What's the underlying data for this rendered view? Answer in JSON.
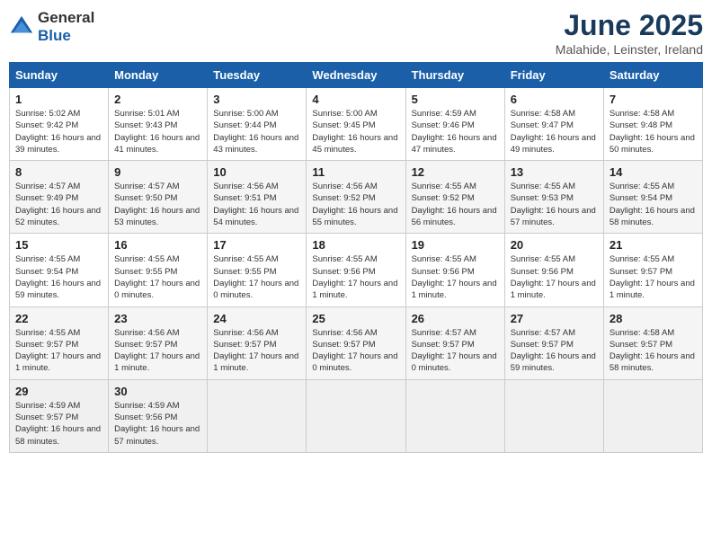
{
  "logo": {
    "general": "General",
    "blue": "Blue"
  },
  "title": "June 2025",
  "location": "Malahide, Leinster, Ireland",
  "weekdays": [
    "Sunday",
    "Monday",
    "Tuesday",
    "Wednesday",
    "Thursday",
    "Friday",
    "Saturday"
  ],
  "weeks": [
    [
      {
        "day": "1",
        "sunrise": "Sunrise: 5:02 AM",
        "sunset": "Sunset: 9:42 PM",
        "daylight": "Daylight: 16 hours and 39 minutes."
      },
      {
        "day": "2",
        "sunrise": "Sunrise: 5:01 AM",
        "sunset": "Sunset: 9:43 PM",
        "daylight": "Daylight: 16 hours and 41 minutes."
      },
      {
        "day": "3",
        "sunrise": "Sunrise: 5:00 AM",
        "sunset": "Sunset: 9:44 PM",
        "daylight": "Daylight: 16 hours and 43 minutes."
      },
      {
        "day": "4",
        "sunrise": "Sunrise: 5:00 AM",
        "sunset": "Sunset: 9:45 PM",
        "daylight": "Daylight: 16 hours and 45 minutes."
      },
      {
        "day": "5",
        "sunrise": "Sunrise: 4:59 AM",
        "sunset": "Sunset: 9:46 PM",
        "daylight": "Daylight: 16 hours and 47 minutes."
      },
      {
        "day": "6",
        "sunrise": "Sunrise: 4:58 AM",
        "sunset": "Sunset: 9:47 PM",
        "daylight": "Daylight: 16 hours and 49 minutes."
      },
      {
        "day": "7",
        "sunrise": "Sunrise: 4:58 AM",
        "sunset": "Sunset: 9:48 PM",
        "daylight": "Daylight: 16 hours and 50 minutes."
      }
    ],
    [
      {
        "day": "8",
        "sunrise": "Sunrise: 4:57 AM",
        "sunset": "Sunset: 9:49 PM",
        "daylight": "Daylight: 16 hours and 52 minutes."
      },
      {
        "day": "9",
        "sunrise": "Sunrise: 4:57 AM",
        "sunset": "Sunset: 9:50 PM",
        "daylight": "Daylight: 16 hours and 53 minutes."
      },
      {
        "day": "10",
        "sunrise": "Sunrise: 4:56 AM",
        "sunset": "Sunset: 9:51 PM",
        "daylight": "Daylight: 16 hours and 54 minutes."
      },
      {
        "day": "11",
        "sunrise": "Sunrise: 4:56 AM",
        "sunset": "Sunset: 9:52 PM",
        "daylight": "Daylight: 16 hours and 55 minutes."
      },
      {
        "day": "12",
        "sunrise": "Sunrise: 4:55 AM",
        "sunset": "Sunset: 9:52 PM",
        "daylight": "Daylight: 16 hours and 56 minutes."
      },
      {
        "day": "13",
        "sunrise": "Sunrise: 4:55 AM",
        "sunset": "Sunset: 9:53 PM",
        "daylight": "Daylight: 16 hours and 57 minutes."
      },
      {
        "day": "14",
        "sunrise": "Sunrise: 4:55 AM",
        "sunset": "Sunset: 9:54 PM",
        "daylight": "Daylight: 16 hours and 58 minutes."
      }
    ],
    [
      {
        "day": "15",
        "sunrise": "Sunrise: 4:55 AM",
        "sunset": "Sunset: 9:54 PM",
        "daylight": "Daylight: 16 hours and 59 minutes."
      },
      {
        "day": "16",
        "sunrise": "Sunrise: 4:55 AM",
        "sunset": "Sunset: 9:55 PM",
        "daylight": "Daylight: 17 hours and 0 minutes."
      },
      {
        "day": "17",
        "sunrise": "Sunrise: 4:55 AM",
        "sunset": "Sunset: 9:55 PM",
        "daylight": "Daylight: 17 hours and 0 minutes."
      },
      {
        "day": "18",
        "sunrise": "Sunrise: 4:55 AM",
        "sunset": "Sunset: 9:56 PM",
        "daylight": "Daylight: 17 hours and 1 minute."
      },
      {
        "day": "19",
        "sunrise": "Sunrise: 4:55 AM",
        "sunset": "Sunset: 9:56 PM",
        "daylight": "Daylight: 17 hours and 1 minute."
      },
      {
        "day": "20",
        "sunrise": "Sunrise: 4:55 AM",
        "sunset": "Sunset: 9:56 PM",
        "daylight": "Daylight: 17 hours and 1 minute."
      },
      {
        "day": "21",
        "sunrise": "Sunrise: 4:55 AM",
        "sunset": "Sunset: 9:57 PM",
        "daylight": "Daylight: 17 hours and 1 minute."
      }
    ],
    [
      {
        "day": "22",
        "sunrise": "Sunrise: 4:55 AM",
        "sunset": "Sunset: 9:57 PM",
        "daylight": "Daylight: 17 hours and 1 minute."
      },
      {
        "day": "23",
        "sunrise": "Sunrise: 4:56 AM",
        "sunset": "Sunset: 9:57 PM",
        "daylight": "Daylight: 17 hours and 1 minute."
      },
      {
        "day": "24",
        "sunrise": "Sunrise: 4:56 AM",
        "sunset": "Sunset: 9:57 PM",
        "daylight": "Daylight: 17 hours and 1 minute."
      },
      {
        "day": "25",
        "sunrise": "Sunrise: 4:56 AM",
        "sunset": "Sunset: 9:57 PM",
        "daylight": "Daylight: 17 hours and 0 minutes."
      },
      {
        "day": "26",
        "sunrise": "Sunrise: 4:57 AM",
        "sunset": "Sunset: 9:57 PM",
        "daylight": "Daylight: 17 hours and 0 minutes."
      },
      {
        "day": "27",
        "sunrise": "Sunrise: 4:57 AM",
        "sunset": "Sunset: 9:57 PM",
        "daylight": "Daylight: 16 hours and 59 minutes."
      },
      {
        "day": "28",
        "sunrise": "Sunrise: 4:58 AM",
        "sunset": "Sunset: 9:57 PM",
        "daylight": "Daylight: 16 hours and 58 minutes."
      }
    ],
    [
      {
        "day": "29",
        "sunrise": "Sunrise: 4:59 AM",
        "sunset": "Sunset: 9:57 PM",
        "daylight": "Daylight: 16 hours and 58 minutes."
      },
      {
        "day": "30",
        "sunrise": "Sunrise: 4:59 AM",
        "sunset": "Sunset: 9:56 PM",
        "daylight": "Daylight: 16 hours and 57 minutes."
      },
      null,
      null,
      null,
      null,
      null
    ]
  ]
}
